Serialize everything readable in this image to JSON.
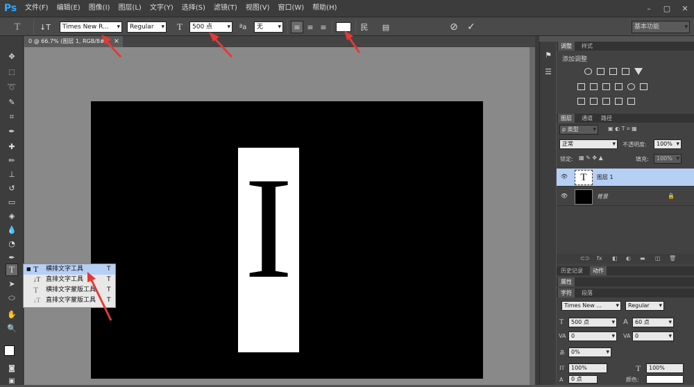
{
  "app": {
    "logo": "Ps"
  },
  "menu": [
    "文件(F)",
    "编辑(E)",
    "图像(I)",
    "图层(L)",
    "文字(Y)",
    "选择(S)",
    "滤镜(T)",
    "视图(V)",
    "窗口(W)",
    "帮助(H)"
  ],
  "window_controls": {
    "minimize": "–",
    "restore": "▢",
    "close": "✕"
  },
  "options": {
    "font_family": "Times New R...",
    "font_style": "Regular",
    "font_size": "500 点",
    "antialias": "无",
    "workspace": "基本功能"
  },
  "doc_tab": "0 @ 66.7% (图层 1, RGB/8#)",
  "doc_tab_close": "×",
  "canvas_letter": "I",
  "type_flyout": [
    {
      "label": "横排文字工具",
      "shortcut": "T",
      "icon": "T",
      "selected": true
    },
    {
      "label": "直排文字工具",
      "shortcut": "T",
      "icon": "↓T",
      "selected": false
    },
    {
      "label": "横排文字蒙版工具",
      "shortcut": "T",
      "icon": "T",
      "selected": false
    },
    {
      "label": "直排文字蒙版工具",
      "shortcut": "T",
      "icon": "↓T",
      "selected": false
    }
  ],
  "adjust_panel": {
    "tabs": [
      "调整",
      "样式"
    ],
    "title": "添加调整"
  },
  "layers_panel": {
    "tabs": [
      "图层",
      "通道",
      "路径"
    ],
    "filter_kind": "ρ 类型",
    "blend_mode": "正常",
    "opacity_label": "不透明度:",
    "opacity": "100%",
    "lock_label": "锁定:",
    "fill_label": "填充:",
    "fill": "100%",
    "layers": [
      {
        "name": "图层 1",
        "thumb": "T",
        "selected": true
      },
      {
        "name": "背景",
        "thumb": "",
        "selected": false,
        "lock": "🔒"
      }
    ],
    "footer_icons": [
      "⊂⊃",
      "fx",
      "◧",
      "◐",
      "▬",
      "◫",
      "🗑"
    ]
  },
  "history_tabs": [
    "历史记录",
    "动作"
  ],
  "properties_tab": "属性",
  "char_panel": {
    "tabs": [
      "字符",
      "段落"
    ],
    "font_family": "Times New ...",
    "font_style": "Regular",
    "size": "500 点",
    "leading": "60 点",
    "kerning_label": "VA",
    "kerning": "0",
    "tracking_label": "VA",
    "tracking": "0",
    "scale_label": "あ",
    "scale": "0%",
    "vscale_label": "IT",
    "vscale": "100%",
    "hscale_label": "T",
    "hscale": "100%",
    "baseline_label": "A",
    "baseline": "0 点",
    "color_label": "颜色:",
    "size_icon": "T",
    "leading_icon": "A"
  },
  "colors": {
    "accent": "#31a8ff",
    "selection": "#b6cff5"
  }
}
